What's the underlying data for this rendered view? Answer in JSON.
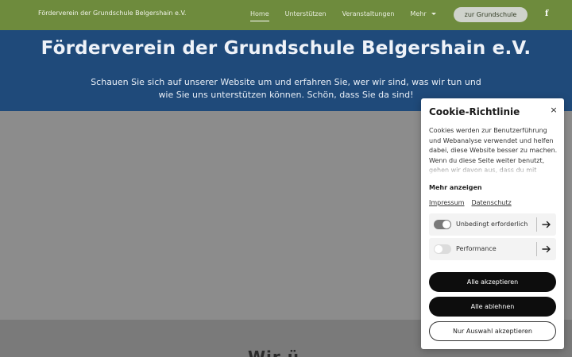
{
  "nav": {
    "site_name": "Förderverein der Grundschule Belgershain e.V.",
    "items": [
      {
        "label": "Home",
        "active": true
      },
      {
        "label": "Unterstützen"
      },
      {
        "label": "Veranstaltungen"
      },
      {
        "label": "Mehr"
      }
    ],
    "cta_label": "zur Grundschule",
    "social_icon": "facebook-icon",
    "social_glyph": "f"
  },
  "hero": {
    "title": "Förderverein der Grundschule Belgershain e.V.",
    "text": "Schauen Sie sich auf unserer Website um und erfahren Sie, wer wir sind, was wir tun und wie Sie uns unterstützen können. Schön, dass Sie da sind!"
  },
  "page": {
    "partial_heading": "Wir ü"
  },
  "cookie": {
    "title": "Cookie-Richtlinie",
    "close_glyph": "×",
    "body": "Cookies werden zur Benutzerführung und Webanalyse verwendet und helfen dabei, diese Website besser zu machen. Wenn du diese Seite weiter benutzt, gehen wir davon aus, dass du mit unseren",
    "more_label": "Mehr anzeigen",
    "links": {
      "impressum": "Impressum",
      "datenschutz": "Datenschutz"
    },
    "prefs": [
      {
        "label": "Unbedingt erforderlich",
        "enabled": true
      },
      {
        "label": "Performance",
        "enabled": false
      }
    ],
    "buttons": {
      "accept_all": "Alle akzeptieren",
      "reject_all": "Alle ablehnen",
      "accept_selection": "Nur Auswahl akzeptieren"
    }
  },
  "colors": {
    "nav_bg": "#6e8b3d",
    "hero_bg": "#1f4a7a",
    "gray": "#8c8c8c",
    "button_dark": "#0d0d0d"
  }
}
